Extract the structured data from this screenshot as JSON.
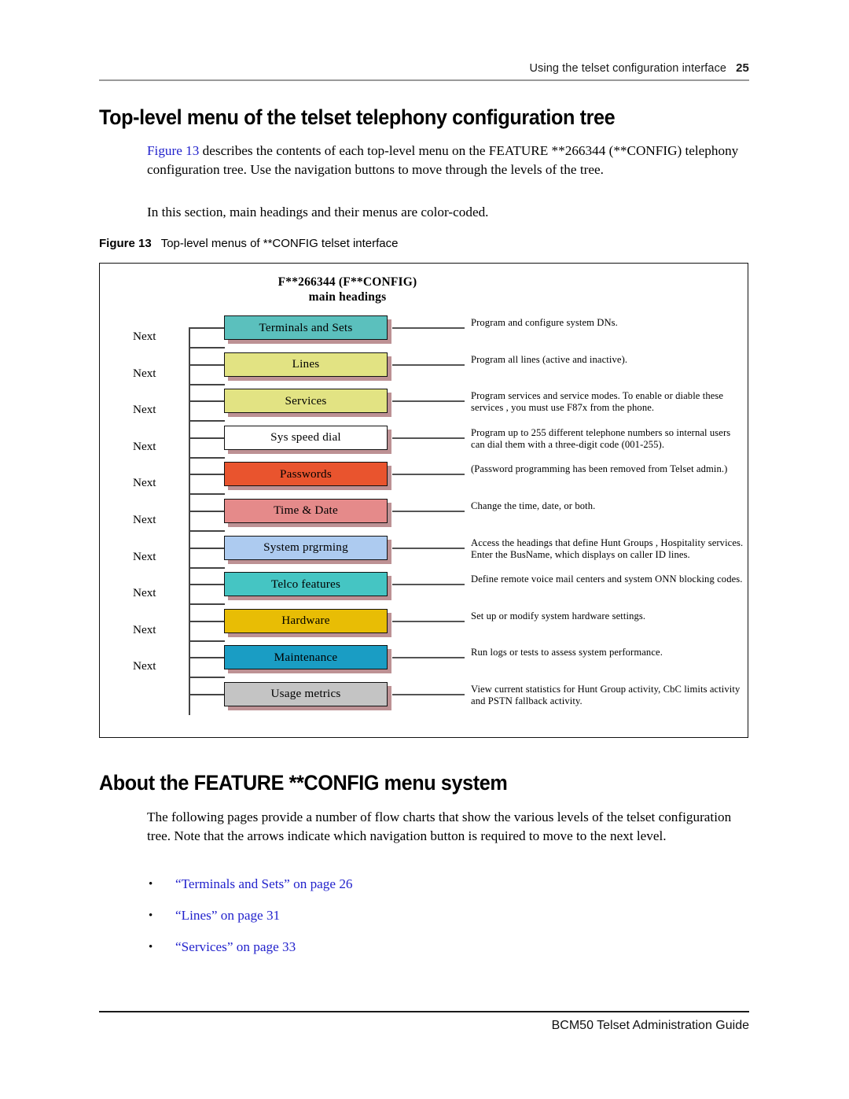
{
  "header": {
    "title": "Using the telset configuration interface",
    "page_number": "25"
  },
  "headings": {
    "top_level": "Top-level menu of the telset telephony configuration tree",
    "about": "About the FEATURE **CONFIG menu system"
  },
  "paragraphs": {
    "intro_link": "Figure 13",
    "intro_rest": " describes the contents of each top-level menu on the FEATURE **266344 (**CONFIG) telephony configuration tree. Use the navigation buttons to move through the levels of the tree.",
    "color_coded": "In this section, main headings and their menus are color-coded.",
    "about_body": "The following pages provide a number of flow charts that show the various levels of the telset configuration tree. Note that the arrows indicate which navigation button is required to move to the next level."
  },
  "figure": {
    "label": "Figure 13",
    "caption": "Top-level menus of **CONFIG telset interface",
    "title_line1": "F**266344  (F**CONFIG)",
    "title_line2": "main headings",
    "next_label": "Next",
    "rows": [
      {
        "label": "Terminals and Sets",
        "color": "#5bc0bd",
        "description": "Program and configure system DNs."
      },
      {
        "label": "Lines",
        "color": "#e2e383",
        "description": "Program all lines (active and inactive)."
      },
      {
        "label": "Services",
        "color": "#e2e383",
        "description": "Program services and service modes.  To enable or diable these services , you must use F87x from the phone."
      },
      {
        "label": "Sys speed dial",
        "color": "#ffffff",
        "description": "Program up to 255 different telephone numbers so internal users can dial them with a three-digit code (001-255)."
      },
      {
        "label": "Passwords",
        "color": "#e9542e",
        "description": "(Password programming has been removed from Telset admin.)"
      },
      {
        "label": "Time & Date",
        "color": "#e58a8a",
        "description": "Change the time, date, or both."
      },
      {
        "label": "System prgrming",
        "color": "#adcbf0",
        "description": "Access the headings that define Hunt Groups , Hospitality services. Enter the BusName, which displays on caller ID lines."
      },
      {
        "label": "Telco features",
        "color": "#45c5c3",
        "description": "Define remote voice mail centers and system ONN blocking codes."
      },
      {
        "label": "Hardware",
        "color": "#e8bd05",
        "description": "Set up or modify system hardware settings."
      },
      {
        "label": "Maintenance",
        "color": "#1a9dc4",
        "description": "Run logs or tests to assess system performance."
      },
      {
        "label": "Usage metrics",
        "color": "#c4c4c4",
        "description": "View current statistics for Hunt Group activity, CbC limits activity and PSTN fallback activity."
      }
    ]
  },
  "bullets": [
    "“Terminals and Sets” on page 26",
    "“Lines” on page 31",
    "“Services” on page 33"
  ],
  "footer": {
    "text": "BCM50 Telset Administration Guide"
  }
}
